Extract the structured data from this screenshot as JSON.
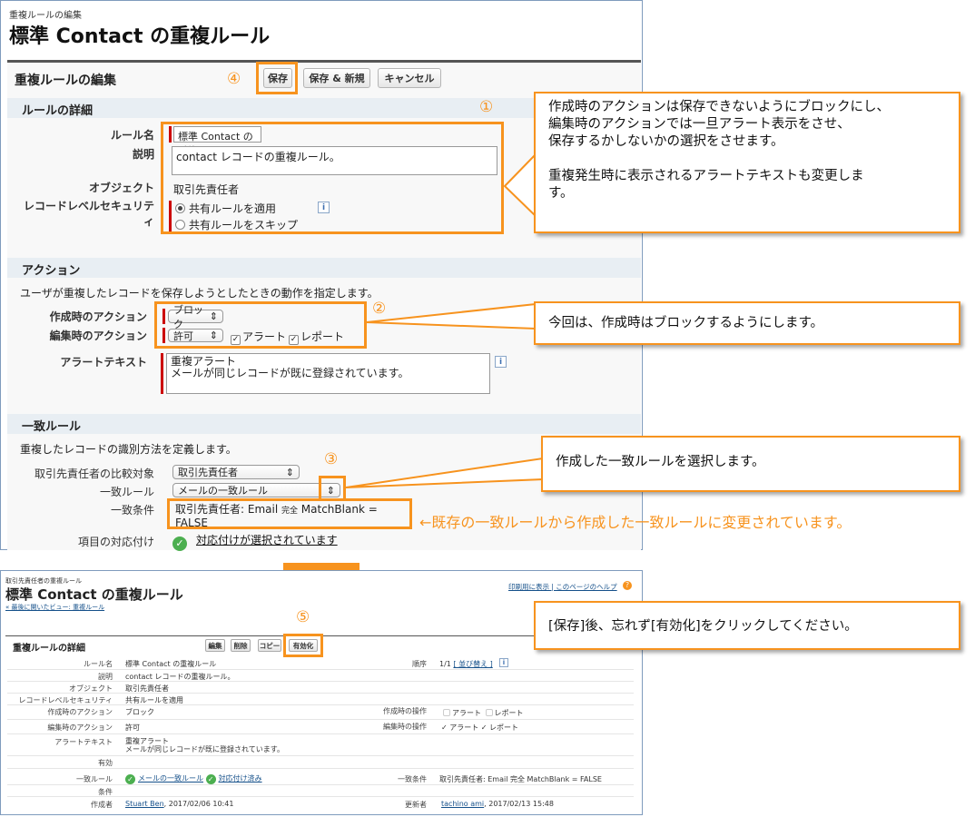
{
  "top": {
    "breadcrumb": "重複ルールの編集",
    "title": "標準 Contact の重複ルール",
    "edit_header": "重複ルールの編集",
    "buttons": {
      "save": "保存",
      "save_new": "保存 & 新規",
      "cancel": "キャンセル"
    },
    "detail_section": "ルールの詳細",
    "fields": {
      "rule_name_label": "ルール名",
      "rule_name_value": "標準 Contact の重複.",
      "description_label": "説明",
      "description_value": "contact レコードの重複ルール。",
      "object_label": "オブジェクト",
      "object_value": "取引先責任者",
      "security_label": "レコードレベルセキュリティ",
      "security_opt1": "共有ルールを適用",
      "security_opt2": "共有ルールをスキップ"
    },
    "action_section": "アクション",
    "action_desc": "ユーザが重複したレコードを保存しようとしたときの動作を指定します。",
    "create_action_label": "作成時のアクション",
    "create_action_value": "ブロック",
    "edit_action_label": "編集時のアクション",
    "edit_action_value": "許可",
    "alert_cb": "アラート",
    "report_cb": "レポート",
    "alert_text_label": "アラートテキスト",
    "alert_text_line1": "重複アラート",
    "alert_text_line2": "メールが同じレコードが既に登録されています。",
    "match_section": "一致ルール",
    "match_desc": "重複したレコードの識別方法を定義します。",
    "compare_label": "取引先責任者の比較対象",
    "compare_value": "取引先責任者",
    "match_rule_label": "一致ルール",
    "match_rule_value": "メールの一致ルール",
    "match_cond_label": "一致条件",
    "match_cond_prefix": "取引先責任者: Email ",
    "match_cond_small": "完全",
    "match_cond_suffix": " MatchBlank =",
    "match_cond_line2": "FALSE",
    "mapping_label": "項目の対応付け",
    "mapping_value": "対応付けが選択されています"
  },
  "callouts": {
    "c1": [
      "作成時のアクションは保存できないようにブロックにし、",
      "編集時のアクションでは一旦アラート表示をさせ、",
      "保存するかしないかの選択をさせます。",
      "",
      "重複発生時に表示されるアラートテキストも変更しま",
      "す。"
    ],
    "c2": "今回は、作成時はブロックするようにします。",
    "c3": "作成した一致ルールを選択します。",
    "c4": "←既存の一致ルールから作成した一致ルールに変更されています。",
    "c5": "[保存]後、忘れず[有効化]をクリックしてください。"
  },
  "numbers": {
    "n1": "①",
    "n2": "②",
    "n3": "③",
    "n4": "④",
    "n5": "⑤"
  },
  "bottom": {
    "breadcrumb": "取引先責任者の重複ルール",
    "title": "標準 Contact の重複ルール",
    "back_link": "« 最後に開いたビュー: 重複ルール",
    "help_links": "印刷用に表示 | このページのヘルプ",
    "detail_header": "重複ルールの詳細",
    "buttons": {
      "edit": "編集",
      "delete": "削除",
      "copy": "コピー",
      "activate": "有効化"
    },
    "rows": {
      "rule_name_l": "ルール名",
      "rule_name_v": "標準 Contact の重複ルール",
      "order_l": "順序",
      "order_v": "1/1",
      "order_link": "[ 並び替え ]",
      "desc_l": "説明",
      "desc_v": "contact レコードの重複ルール。",
      "obj_l": "オブジェクト",
      "obj_v": "取引先責任者",
      "sec_l": "レコードレベルセキュリティ",
      "sec_v": "共有ルールを適用",
      "create_l": "作成時のアクション",
      "create_v": "ブロック",
      "create_op_l": "作成時の操作",
      "create_op_alert": "アラート",
      "create_op_report": "レポート",
      "edit_l": "編集時のアクション",
      "edit_v": "許可",
      "edit_op_l": "編集時の操作",
      "edit_op_alert": "アラート",
      "edit_op_report": "レポート",
      "alert_l": "アラートテキスト",
      "alert_v1": "重複アラート",
      "alert_v2": "メールが同じレコードが既に登録されています。",
      "active_l": "有効",
      "match_l": "一致ルール",
      "match_v": "メールの一致ルール",
      "match_v2": "対応付け済み",
      "match_cond_l": "一致条件",
      "match_cond_v": "取引先責任者: Email 完全 MatchBlank = FALSE",
      "cond_l": "条件",
      "creator_l": "作成者",
      "creator_name": "Stuart Ben",
      "creator_date": ", 2017/02/06 10:41",
      "updater_l": "更新者",
      "updater_name": "tachino ami",
      "updater_date": ", 2017/02/13 15:48"
    }
  },
  "colors": {
    "accent": "#f7931e",
    "link": "#15508a",
    "required": "#cc0000"
  }
}
